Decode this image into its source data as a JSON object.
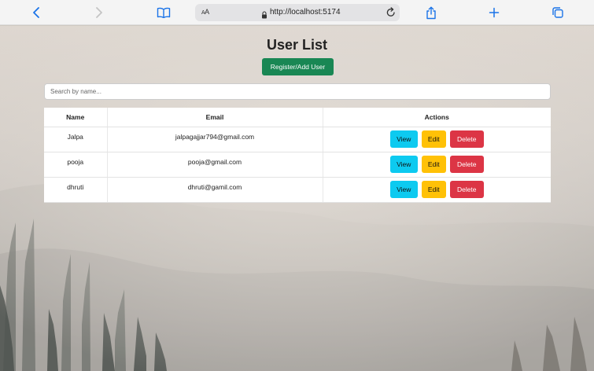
{
  "browser": {
    "text_size_label": "AA",
    "url": "http://localhost:5174",
    "icons": [
      "back-icon",
      "forward-icon",
      "bookmarks-icon",
      "lock-icon",
      "reload-icon",
      "share-icon",
      "new-tab-icon",
      "tabs-icon"
    ]
  },
  "page": {
    "title": "User List",
    "add_button_label": "Register/Add User",
    "search_placeholder": "Search by name..."
  },
  "table": {
    "columns": [
      "Name",
      "Email",
      "Actions"
    ],
    "rows": [
      {
        "name": "Jalpa",
        "email": "jalpagajjar794@gmail.com"
      },
      {
        "name": "pooja",
        "email": "pooja@gmail.com"
      },
      {
        "name": "dhruti",
        "email": "dhruti@gamil.com"
      }
    ],
    "actions": {
      "view": "View",
      "edit": "Edit",
      "delete": "Delete"
    }
  },
  "colors": {
    "add_button": "#198754",
    "view_button": "#0dcaf0",
    "edit_button": "#ffc107",
    "delete_button": "#dc3545",
    "browser_accent": "#1a73e8"
  }
}
